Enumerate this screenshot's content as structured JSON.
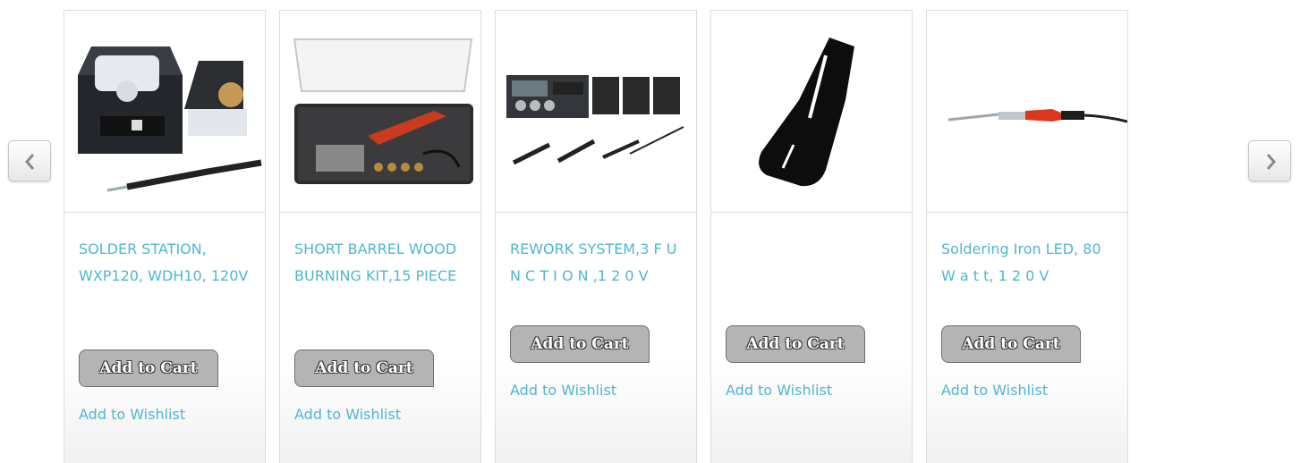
{
  "carousel": {
    "prev_icon": "chevron-left-icon",
    "next_icon": "chevron-right-icon",
    "products": [
      {
        "name": "SOLDER STATION, WXP120, WDH10, 120V",
        "cart_label": "Add to Cart",
        "wishlist_label": "Add to Wishlist",
        "image": "solder-station-image"
      },
      {
        "name": "SHORT BARREL WOOD BURNING KIT,15 PIECE",
        "cart_label": "Add to Cart",
        "wishlist_label": "Add to Wishlist",
        "image": "wood-burning-kit-image"
      },
      {
        "name": "REWORK SYSTEM,3 F U N C T I O N ,1 2 0 V",
        "cart_label": "Add to Cart",
        "wishlist_label": "Add to Wishlist",
        "image": "rework-system-image"
      },
      {
        "name": "",
        "cart_label": "Add to Cart",
        "wishlist_label": "Add to Wishlist",
        "image": "soldering-tip-image"
      },
      {
        "name": "Soldering Iron LED, 80 W a t t, 1 2 0 V",
        "cart_label": "Add to Cart",
        "wishlist_label": "Add to Wishlist",
        "image": "soldering-iron-image"
      }
    ]
  },
  "colors": {
    "link": "#4fb7cf",
    "button": "#b4b4b4"
  }
}
